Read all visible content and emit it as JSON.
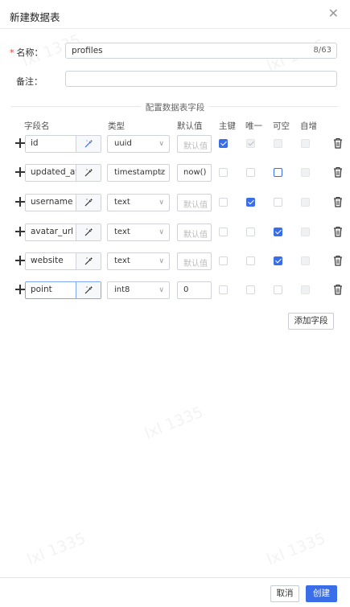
{
  "dialog": {
    "title": "新建数据表",
    "close_icon": "close-icon"
  },
  "form": {
    "name_label": "名称：",
    "name_required_mark": "*",
    "name_value": "profiles",
    "name_counter": "8/63",
    "remark_label": "备注：",
    "remark_value": ""
  },
  "fields_section": {
    "title": "配置数据表字段",
    "headers": {
      "name": "字段名",
      "type": "类型",
      "default": "默认值",
      "primary": "主键",
      "unique": "唯一",
      "nullable": "可空",
      "auto_increment": "自增"
    },
    "rows": [
      {
        "name": "id",
        "type": "uuid",
        "default": "默认值",
        "default_is_placeholder": true,
        "primary": true,
        "unique": true,
        "nullable": false,
        "auto_increment": false
      },
      {
        "name": "updated_at",
        "type": "timestamptz",
        "default": "now()",
        "default_is_placeholder": false,
        "primary": false,
        "unique": false,
        "nullable": false,
        "auto_increment": false
      },
      {
        "name": "username",
        "type": "text",
        "default": "默认值",
        "default_is_placeholder": true,
        "primary": false,
        "unique": true,
        "nullable": false,
        "auto_increment": false
      },
      {
        "name": "avatar_url",
        "type": "text",
        "default": "默认值",
        "default_is_placeholder": true,
        "primary": false,
        "unique": false,
        "nullable": true,
        "auto_increment": false
      },
      {
        "name": "website",
        "type": "text",
        "default": "默认值",
        "default_is_placeholder": true,
        "primary": false,
        "unique": false,
        "nullable": true,
        "auto_increment": false
      },
      {
        "name": "point",
        "type": "int8",
        "default": "0",
        "default_is_placeholder": false,
        "primary": false,
        "unique": false,
        "nullable": false,
        "auto_increment": false
      }
    ],
    "add_field_label": "添加字段"
  },
  "footer": {
    "cancel_label": "取消",
    "create_label": "创建"
  },
  "watermark_text": "lxl 1335",
  "colors": {
    "accent": "#3a6ee8",
    "required": "#e0403a"
  }
}
